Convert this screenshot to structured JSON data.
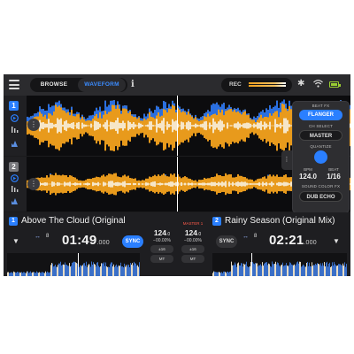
{
  "topbar": {
    "browse_label": "BROWSE",
    "waveform_label": "WAVEFORM",
    "info_glyph": "i",
    "rec_label": "REC",
    "icons": [
      "menu-icon",
      "info-icon",
      "bluetooth-icon",
      "wifi-icon",
      "battery-icon"
    ]
  },
  "decks": [
    {
      "number": "1",
      "track_title": "Above The Cloud (Original",
      "beat_jump": "8",
      "time": "01:49",
      "time_ms": ".000",
      "sync_label": "SYNC",
      "sync_active": true,
      "bpm": "124",
      "bpm_decimal": ".0",
      "pitch": "−00.00%",
      "range_label": "±16",
      "mt_label": "MT",
      "color": "#2a7fff"
    },
    {
      "number": "2",
      "track_title": "Rainy Season (Original Mix)",
      "beat_jump": "8",
      "time": "02:21",
      "time_ms": ".000",
      "sync_label": "SYNC",
      "sync_active": false,
      "bpm": "124",
      "bpm_decimal": ".0",
      "pitch": "−00.00%",
      "range_label": "±16",
      "mt_label": "MT",
      "master_label": "MASTER",
      "master_number": "1",
      "color": "#7a7a7e"
    }
  ],
  "fx_panel": {
    "beat_fx_label": "BEAT FX",
    "beat_fx_value": "FLANGER",
    "ch_select_label": "CH SELECT",
    "ch_select_value": "MASTER",
    "quantize_label": "QUANTIZE",
    "bpm_label": "BPM",
    "bpm_value": "124.0",
    "beat_label": "BEAT",
    "beat_value": "1/16",
    "sound_color_label": "SOUND COLOR FX",
    "sound_color_value": "DUB ECHO"
  },
  "colors": {
    "accent": "#2a7fff",
    "waveform_orange": "#f0a020",
    "waveform_blue": "#2a6fe0",
    "master_red": "#ff5a4a",
    "battery_green": "#9acd32"
  }
}
